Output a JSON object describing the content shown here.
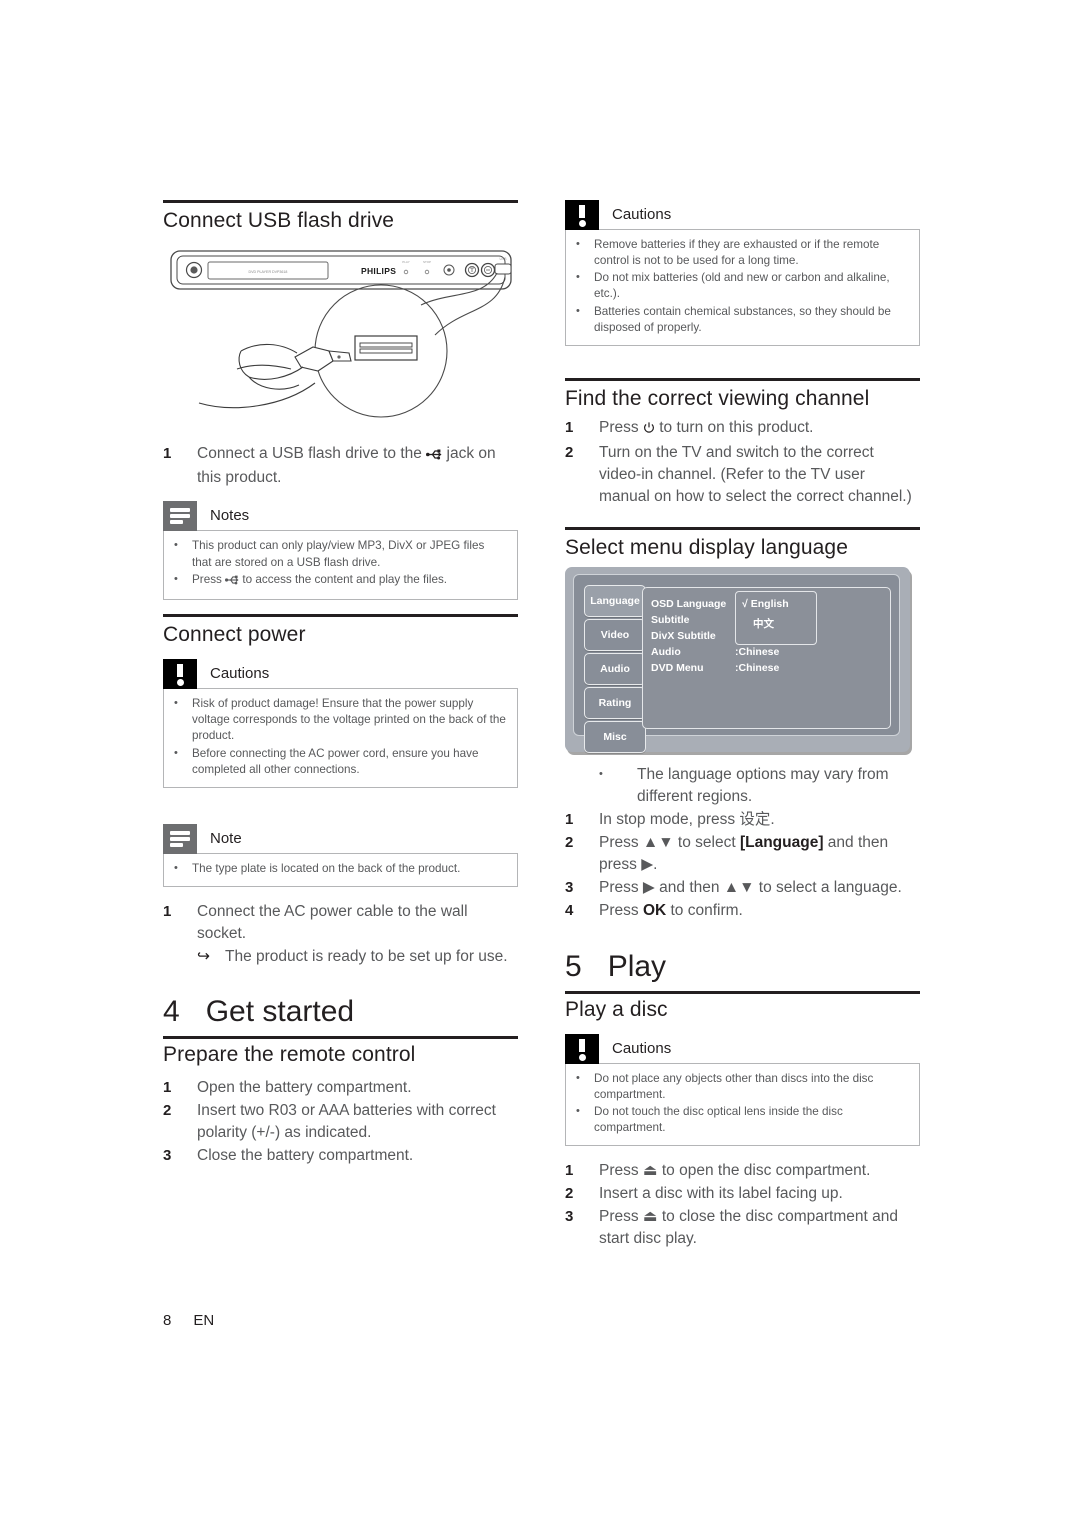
{
  "page": {
    "number": "8",
    "language": "EN"
  },
  "left_column": {
    "section1": {
      "title": "Connect USB flash drive",
      "illustration": {
        "brand_label": "PHILIPS",
        "tray_label": "DVD PLAYER DVP3618",
        "name": "dvd-player-front-panel"
      },
      "steps": [
        {
          "n": "1",
          "text_before": "Connect a USB flash drive to the",
          "icon": "usb-icon",
          "text_after": "jack on this product."
        }
      ],
      "notes": {
        "badge": "notes-icon",
        "title": "Notes",
        "items": [
          "This product can only play/view MP3, DivX or JPEG files that are stored on a USB flash drive.",
          "Press  to access the content and play the files."
        ],
        "item2_before": "Press",
        "item2_icon": "usb-icon",
        "item2_after": "to access the content and play the files."
      }
    },
    "section2": {
      "title": "Connect power",
      "cautions": {
        "badge": "caution-icon",
        "title": "Cautions",
        "items": [
          "Risk of product damage! Ensure that the power supply voltage corresponds to the voltage printed on the back of the product.",
          "Before connecting the AC power cord, ensure you have completed all other connections."
        ]
      },
      "note": {
        "badge": "notes-icon",
        "title": "Note",
        "items": [
          "The type plate is located on the back of the product."
        ]
      },
      "steps": [
        {
          "n": "1",
          "text": "Connect the AC power cable to the wall socket."
        }
      ],
      "result": {
        "arrow": "↪",
        "text": "The product is ready to be set up for use."
      }
    },
    "chapter4": {
      "number": "4",
      "title": "Get started",
      "section": {
        "title": "Prepare the remote control",
        "steps": [
          {
            "n": "1",
            "text": "Open the battery compartment."
          },
          {
            "n": "2",
            "text": "Insert two R03 or AAA batteries with correct polarity (+/-) as indicated."
          },
          {
            "n": "3",
            "text": "Close the battery compartment."
          }
        ]
      }
    }
  },
  "right_column": {
    "cautions_battery": {
      "badge": "caution-icon",
      "title": "Cautions",
      "items": [
        "Remove batteries if they are exhausted or if the remote control is not to be used for a long time.",
        "Do not mix batteries (old and new or carbon and alkaline, etc.).",
        "Batteries contain chemical substances, so they should be disposed of properly."
      ]
    },
    "section_channel": {
      "title": "Find the correct viewing channel",
      "steps": [
        {
          "n": "1",
          "text_before": "Press",
          "icon": "power-icon",
          "text_after": "to turn on this product."
        },
        {
          "n": "2",
          "text": "Turn on the TV and switch to the correct video-in channel. (Refer to the TV user manual on how to select the correct channel.)"
        }
      ]
    },
    "section_language": {
      "title": "Select menu display language",
      "osd": {
        "name": "osd-setup-menu-screenshot",
        "tabs": [
          {
            "label": "Language",
            "selected": true
          },
          {
            "label": "Video",
            "selected": false
          },
          {
            "label": "Audio",
            "selected": false
          },
          {
            "label": "Rating",
            "selected": false
          },
          {
            "label": "Misc",
            "selected": false
          }
        ],
        "rows": [
          {
            "label": "OSD Language",
            "value": ""
          },
          {
            "label": "Subtitle",
            "value": ""
          },
          {
            "label": "DivX Subtitle",
            "value": ""
          },
          {
            "label": "Audio",
            "value": ":Chinese"
          },
          {
            "label": "DVD Menu",
            "value": ":Chinese"
          }
        ],
        "submenu": {
          "options": [
            {
              "label": "English",
              "checked": true,
              "check": "√"
            },
            {
              "label": "中文",
              "checked": false,
              "check": ""
            }
          ]
        }
      },
      "bullet": "The language options may vary from different regions.",
      "steps": [
        {
          "n": "1",
          "text": "In stop mode, press 设定."
        },
        {
          "n": "2",
          "text_parts": [
            "Press ▲▼ to select ",
            "[Language]",
            " and then press ▶."
          ]
        },
        {
          "n": "3",
          "text": "Press ▶ and then ▲▼ to select a language."
        },
        {
          "n": "4",
          "text_parts": [
            "Press ",
            "OK",
            " to confirm."
          ]
        }
      ]
    },
    "chapter5": {
      "number": "5",
      "title": "Play",
      "section": {
        "title": "Play a disc",
        "cautions": {
          "badge": "caution-icon",
          "title": "Cautions",
          "items": [
            "Do not place any objects other than discs into the disc compartment.",
            "Do not touch the disc optical lens inside the disc compartment."
          ]
        },
        "steps": [
          {
            "n": "1",
            "text": "Press ⏏ to open the disc compartment."
          },
          {
            "n": "2",
            "text": "Insert a disc with its label facing up."
          },
          {
            "n": "3",
            "text": "Press ⏏ to close the disc compartment and start disc play."
          }
        ]
      }
    }
  }
}
